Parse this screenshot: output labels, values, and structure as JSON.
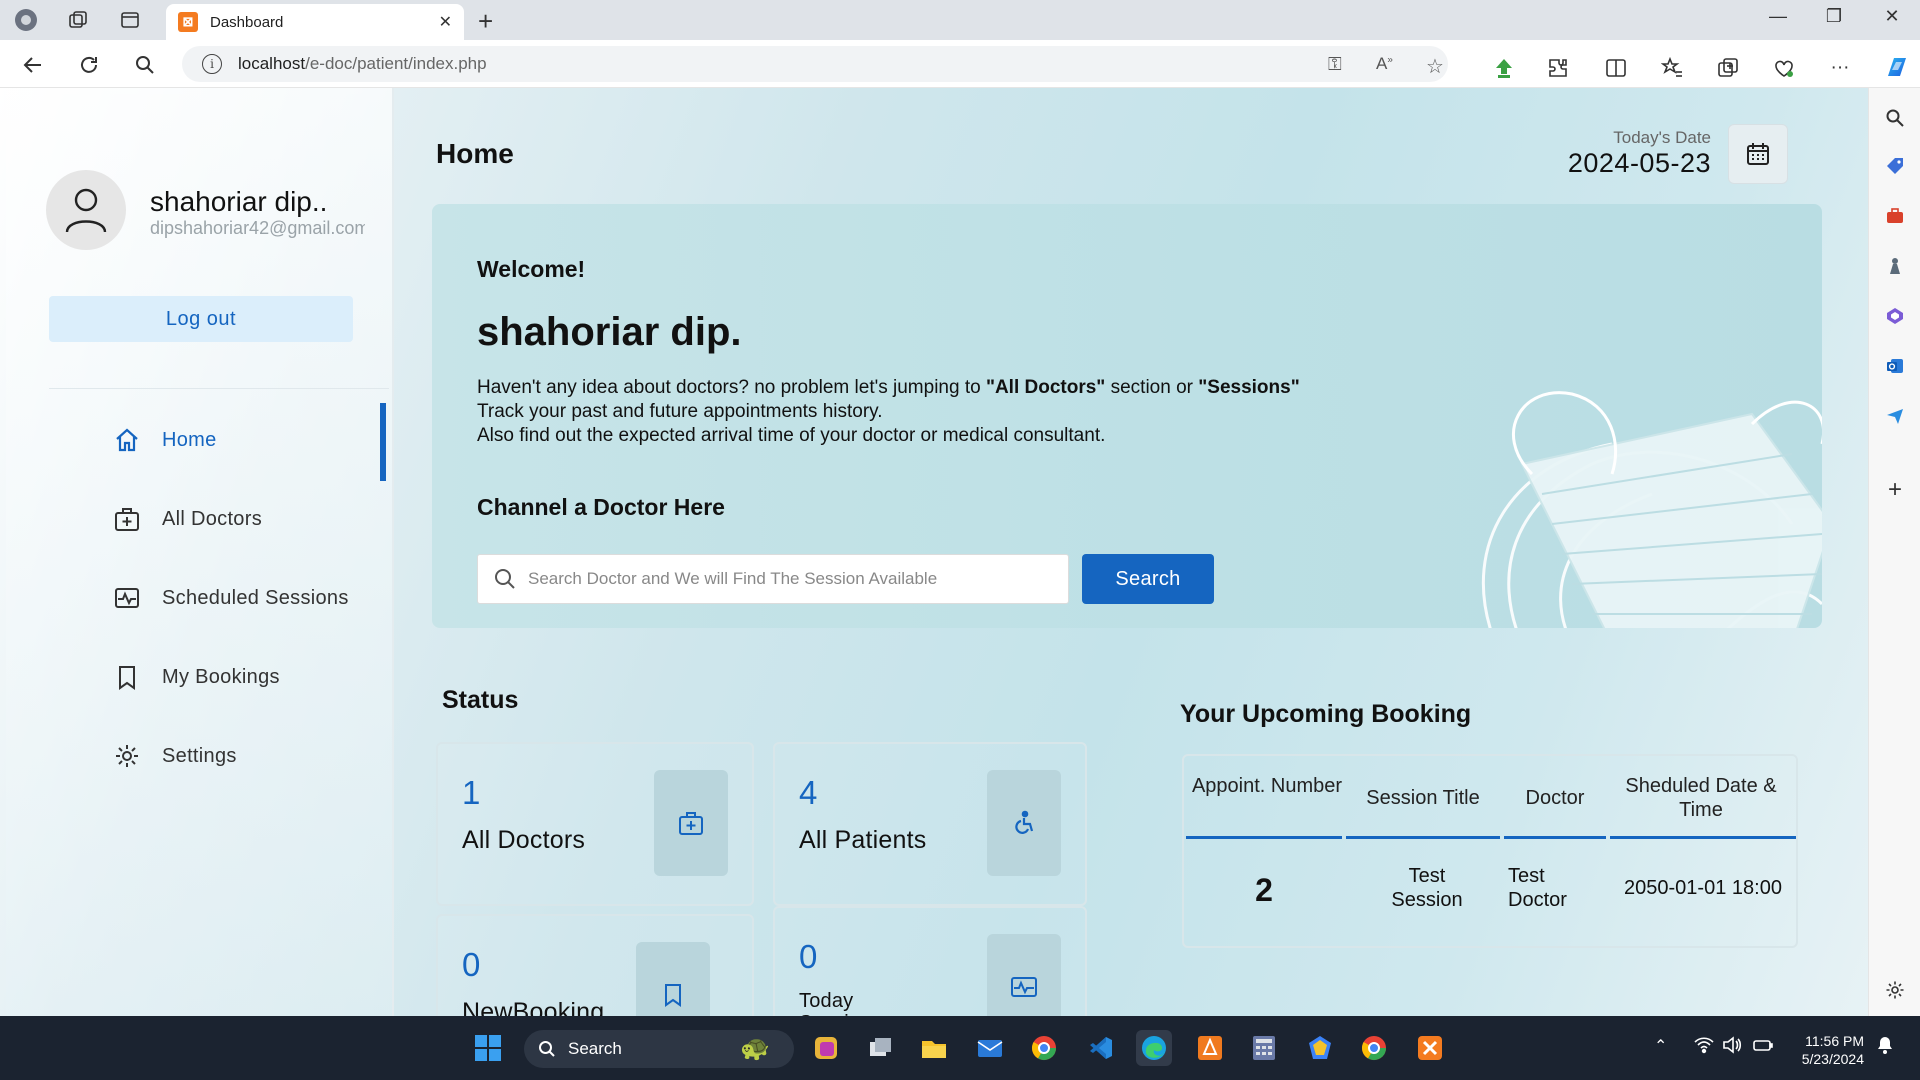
{
  "browser": {
    "tab_title": "Dashboard",
    "url_host": "localhost",
    "url_path": "/e-doc/patient/index.php"
  },
  "profile": {
    "name": "shahoriar dip..",
    "email": "dipshahoriar42@gmail.com",
    "logout_label": "Log out"
  },
  "menu": {
    "items": [
      {
        "label": "Home",
        "icon": "home-icon",
        "active": true
      },
      {
        "label": "All Doctors",
        "icon": "doctor-icon"
      },
      {
        "label": "Scheduled Sessions",
        "icon": "sessions-icon"
      },
      {
        "label": "My Bookings",
        "icon": "bookmark-icon"
      },
      {
        "label": "Settings",
        "icon": "gear-icon"
      }
    ]
  },
  "header": {
    "title": "Home",
    "date_label": "Today's Date",
    "date_value": "2024-05-23"
  },
  "banner": {
    "welcome": "Welcome!",
    "name": "shahoriar dip.",
    "line1_a": "Haven't any idea about doctors? no problem let's jumping to ",
    "line1_b": "\"All Doctors\"",
    "line1_c": " section or ",
    "line1_d": "\"Sessions\"",
    "line2": "Track your past and future appointments history.",
    "line3": "Also find out the expected arrival time of your doctor or medical consultant.",
    "channel_title": "Channel a Doctor Here",
    "search_placeholder": "Search Doctor and We will Find The Session Available",
    "search_button": "Search"
  },
  "status": {
    "title": "Status",
    "cards": [
      {
        "value": "1",
        "label": "All Doctors",
        "icon": "doctor-icon"
      },
      {
        "value": "4",
        "label": "All Patients",
        "icon": "accessible-icon"
      },
      {
        "value": "0",
        "label": "NewBooking",
        "icon": "bookmark-icon"
      },
      {
        "value": "0",
        "label": "Today Sessions",
        "icon": "sessions-icon"
      }
    ]
  },
  "upcoming": {
    "title": "Your Upcoming Booking",
    "headers": [
      "Appoint. Number",
      "Session Title",
      "Doctor",
      "Sheduled Date & Time"
    ],
    "rows": [
      {
        "number": "2",
        "session": "Test Session",
        "doctor": "Test Doctor",
        "datetime": "2050-01-01 18:00"
      }
    ]
  },
  "taskbar": {
    "search_label": "Search",
    "time": "11:56 PM",
    "date": "5/23/2024"
  },
  "colors": {
    "accent": "#1565c0",
    "banner_bg": "#c2e2e7",
    "taskbar_bg": "#1b2330"
  }
}
